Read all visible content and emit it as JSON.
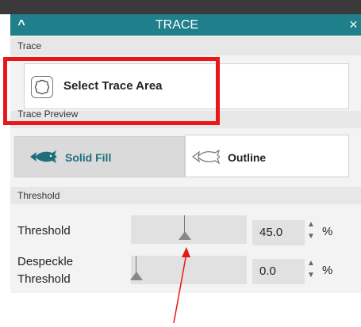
{
  "window": {
    "title": "TRACE",
    "collapse_glyph": "^",
    "close_glyph": "×"
  },
  "trace_section": {
    "header": "Trace",
    "select_area_label": "Select Trace Area",
    "select_area_icon": "trace-area-icon"
  },
  "preview_section": {
    "header": "Trace Preview",
    "solid_fill_label": "Solid Fill",
    "solid_fill_icon": "fish-solid-icon",
    "outline_label": "Outline",
    "outline_icon": "fish-outline-icon",
    "selected": "Solid Fill"
  },
  "threshold_section": {
    "header": "Threshold",
    "rows": [
      {
        "label": "Threshold",
        "value": "45.0",
        "unit": "%",
        "slider_fraction": 0.45
      },
      {
        "label_line1": "Despeckle",
        "label_line2": "Threshold",
        "value": "0.0",
        "unit": "%",
        "slider_fraction": 0.0
      }
    ]
  },
  "spinner": {
    "up": "▲",
    "down": "▼"
  },
  "colors": {
    "accent": "#1f7f8a",
    "highlight_box": "#e81818",
    "arrow": "#e81818"
  }
}
